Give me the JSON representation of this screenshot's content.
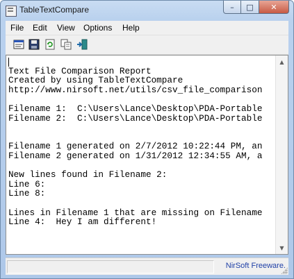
{
  "window": {
    "title": "TableTextCompare"
  },
  "caption_buttons": {
    "minimize": "–",
    "maximize": "□",
    "close": "✕"
  },
  "menu": [
    "File",
    "Edit",
    "View",
    "Options",
    "Help"
  ],
  "toolbar": {
    "buttons": [
      {
        "name": "report-icon"
      },
      {
        "name": "save-icon"
      },
      {
        "name": "refresh-icon"
      },
      {
        "name": "copy-icon"
      },
      {
        "name": "exit-icon"
      }
    ]
  },
  "report": {
    "lines": [
      "Text File Comparison Report",
      "Created by using TableTextCompare",
      "http://www.nirsoft.net/utils/csv_file_comparison",
      "",
      "Filename 1:  C:\\Users\\Lance\\Desktop\\PDA-Portable",
      "Filename 2:  C:\\Users\\Lance\\Desktop\\PDA-Portable",
      "",
      "",
      "Filename 1 generated on 2/7/2012 10:22:44 PM, an",
      "Filename 2 generated on 1/31/2012 12:34:55 AM, a",
      "",
      "New lines found in Filename 2:",
      "Line 6:",
      "Line 8:",
      "",
      "Lines in Filename 1 that are missing on Filename",
      "Line 4:  Hey I am different!"
    ]
  },
  "status": {
    "link": "NirSoft Freeware."
  }
}
